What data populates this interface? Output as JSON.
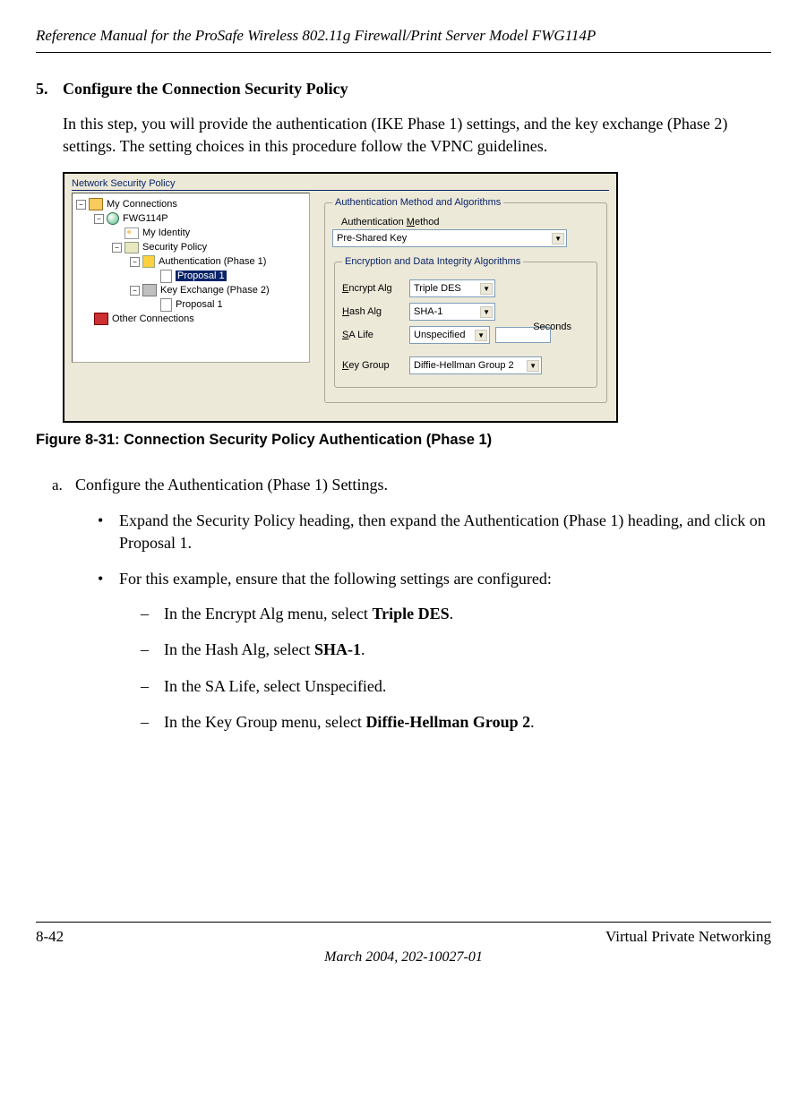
{
  "header": {
    "title": "Reference Manual for the ProSafe Wireless 802.11g  Firewall/Print Server Model FWG114P"
  },
  "step": {
    "number": "5.",
    "title": "Configure the Connection Security Policy",
    "intro": "In this step, you will provide the authentication (IKE Phase 1) settings, and the key exchange (Phase 2) settings. The setting choices in this procedure follow the VPNC guidelines."
  },
  "screenshot": {
    "groupbox_title": "Network Security Policy",
    "tree": {
      "root": "My Connections",
      "conn": "FWG114P",
      "identity": "My Identity",
      "policy": "Security Policy",
      "auth": "Authentication (Phase 1)",
      "proposal_selected": "Proposal 1",
      "keyexch": "Key Exchange (Phase 2)",
      "proposal_2": "Proposal 1",
      "other": "Other Connections"
    },
    "auth_group": {
      "legend": "Authentication Method and Algorithms",
      "auth_method_label": "Authentication Method",
      "auth_method_value": "Pre-Shared Key"
    },
    "enc_group": {
      "legend": "Encryption and Data Integrity Algorithms",
      "encrypt_label_pre": "E",
      "encrypt_label_u": "n",
      "encrypt_label_post": "crypt Alg",
      "encrypt_value": "Triple DES",
      "hash_label_u": "H",
      "hash_label_post": "ash Alg",
      "hash_value": "SHA-1",
      "sa_label_u": "S",
      "sa_label_post": "A Life",
      "sa_value": "Unspecified",
      "seconds_label": "Seconds",
      "key_label_u": "K",
      "key_label_post": "ey Group",
      "key_value": "Diffie-Hellman Group 2"
    }
  },
  "figure_caption": "Figure 8-31:  Connection Security Policy Authentication (Phase 1)",
  "substep": {
    "a": "Configure the Authentication (Phase 1) Settings.",
    "bullets": [
      "Expand the Security Policy heading, then expand the Authentication (Phase 1) heading, and click on Proposal 1.",
      "For this example, ensure that the following settings are configured:"
    ],
    "dashes": [
      {
        "pre": "In the Encrypt Alg menu, select ",
        "bold": "Triple DES",
        "post": "."
      },
      {
        "pre": "In the Hash Alg, select ",
        "bold": "SHA-1",
        "post": "."
      },
      {
        "pre": "In the SA Life, select Unspecified.",
        "bold": "",
        "post": ""
      },
      {
        "pre": "In the Key Group menu, select ",
        "bold": "Diffie-Hellman Group 2",
        "post": "."
      }
    ]
  },
  "footer": {
    "page": "8-42",
    "section": "Virtual Private Networking",
    "date": "March 2004, 202-10027-01"
  }
}
